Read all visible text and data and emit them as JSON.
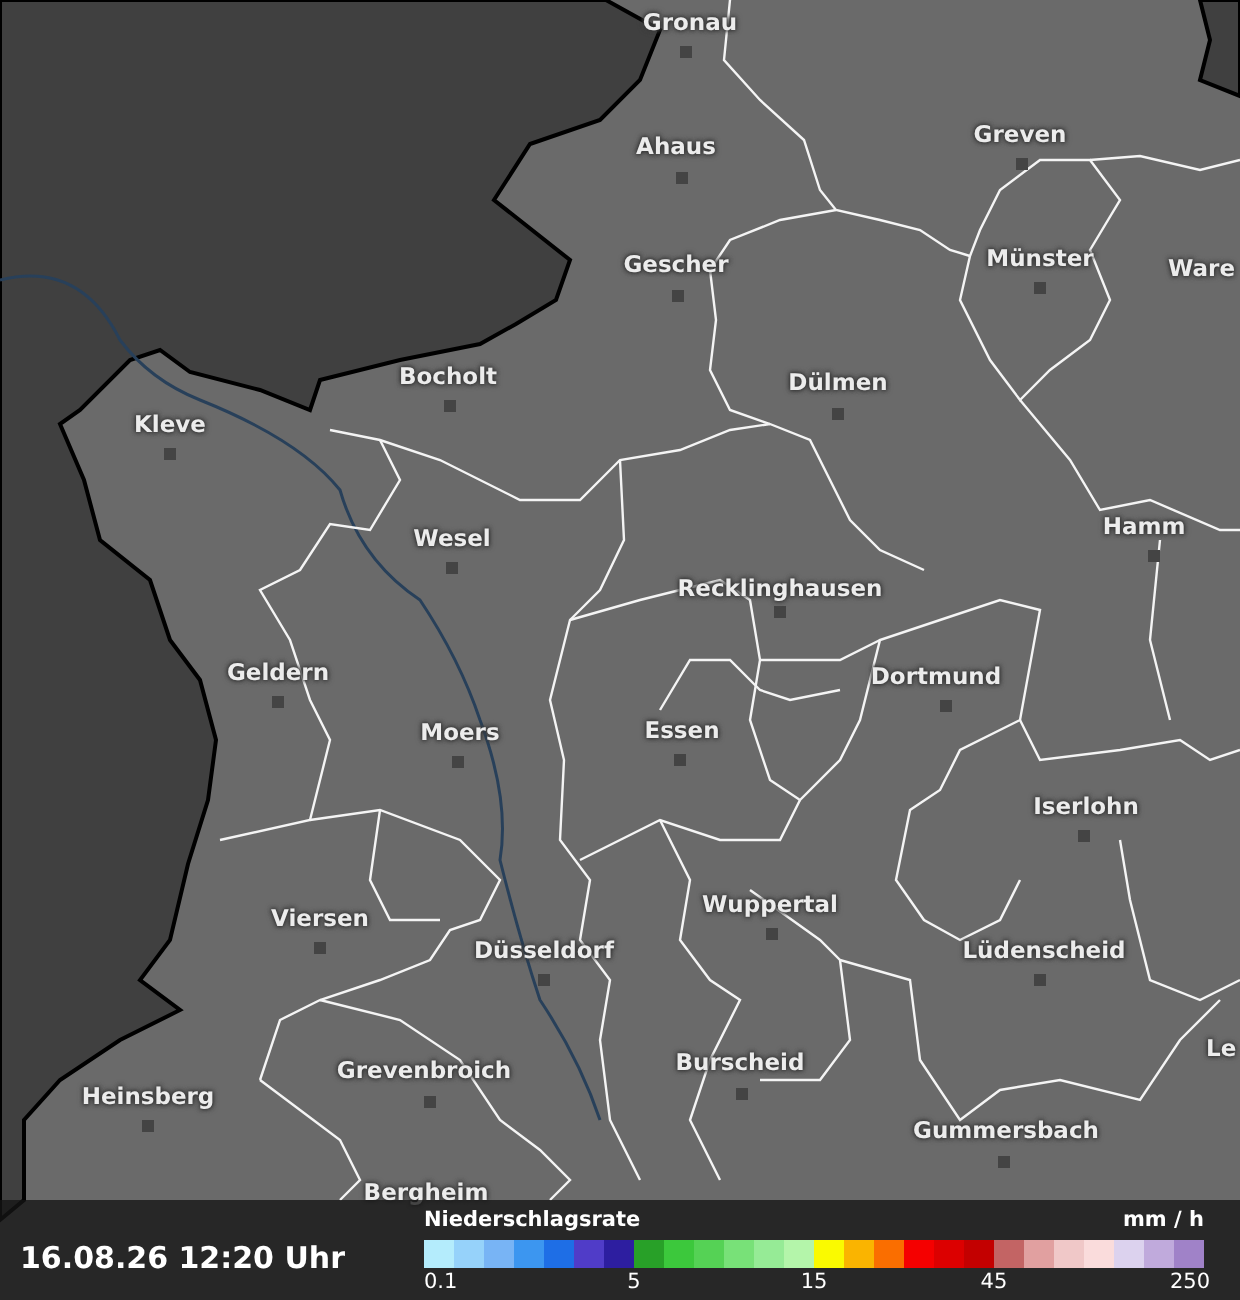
{
  "map": {
    "cities": [
      {
        "name": "Gronau"
      },
      {
        "name": "Ahaus"
      },
      {
        "name": "Greven"
      },
      {
        "name": "Gescher"
      },
      {
        "name": "Münster"
      },
      {
        "name": "Ware"
      },
      {
        "name": "Bocholt"
      },
      {
        "name": "Dülmen"
      },
      {
        "name": "Kleve"
      },
      {
        "name": "Wesel"
      },
      {
        "name": "Hamm"
      },
      {
        "name": "Recklinghausen"
      },
      {
        "name": "Geldern"
      },
      {
        "name": "Dortmund"
      },
      {
        "name": "Moers"
      },
      {
        "name": "Essen"
      },
      {
        "name": "Iserlohn"
      },
      {
        "name": "Wuppertal"
      },
      {
        "name": "Viersen"
      },
      {
        "name": "Düsseldorf"
      },
      {
        "name": "Lüdenscheid"
      },
      {
        "name": "Le"
      },
      {
        "name": "Grevenbroich"
      },
      {
        "name": "Burscheid"
      },
      {
        "name": "Heinsberg"
      },
      {
        "name": "Gummersbach"
      },
      {
        "name": "Bergheim"
      }
    ]
  },
  "timestamp": "16.08.26 12:20 Uhr",
  "legend": {
    "title": "Niederschlagsrate",
    "unit": "mm / h",
    "colors": [
      {
        "color": "#b4ecfc"
      },
      {
        "color": "#96d2fa"
      },
      {
        "color": "#78b4f5"
      },
      {
        "color": "#3c96f0"
      },
      {
        "color": "#1e6ee6"
      },
      {
        "color": "#503cc8"
      },
      {
        "color": "#2d1ea0"
      },
      {
        "color": "#28a028"
      },
      {
        "color": "#3cc83c"
      },
      {
        "color": "#55d255"
      },
      {
        "color": "#78e178"
      },
      {
        "color": "#96eb96"
      },
      {
        "color": "#b4f5aa"
      },
      {
        "color": "#fafa00"
      },
      {
        "color": "#fab400"
      },
      {
        "color": "#fa6e00"
      },
      {
        "color": "#f50000"
      },
      {
        "color": "#dc0000"
      },
      {
        "color": "#c30000"
      },
      {
        "color": "#c36464"
      },
      {
        "color": "#e1a0a0"
      },
      {
        "color": "#f0c8c8"
      },
      {
        "color": "#fadcdc"
      },
      {
        "color": "#dcd2ee"
      },
      {
        "color": "#c0aadc"
      },
      {
        "color": "#a082c8"
      }
    ],
    "ticks": [
      {
        "label": "0.1"
      },
      {
        "label": "5"
      },
      {
        "label": "15"
      },
      {
        "label": "45"
      },
      {
        "label": "250"
      }
    ]
  }
}
